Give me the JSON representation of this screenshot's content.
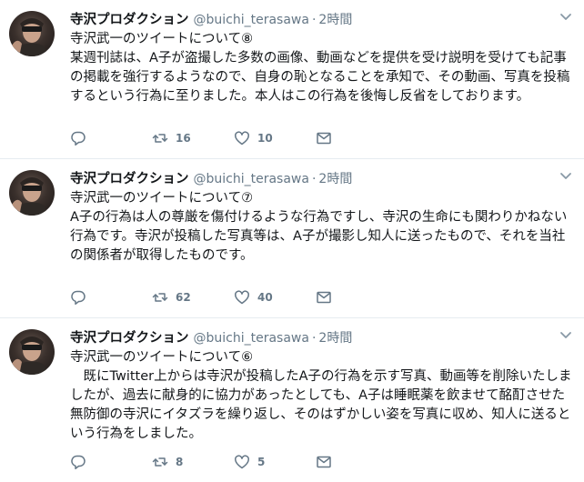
{
  "tweets": [
    {
      "name": "寺沢プロダクション",
      "handle": "@buichi_terasawa",
      "separator": "·",
      "time": "2時間",
      "lines": [
        "寺沢武一のツイートについて⑧",
        "某週刊誌は、A子が盗撮した多数の画像、動画などを提供を受け説明を受けても記事の掲載を強行するようなので、自身の恥となることを承知で、その動画、写真を投稿するという行為に至りました。本人はこの行為を後悔し反省をしております。"
      ],
      "replies": "",
      "retweets": "16",
      "likes": "10"
    },
    {
      "name": "寺沢プロダクション",
      "handle": "@buichi_terasawa",
      "separator": "·",
      "time": "2時間",
      "lines": [
        "寺沢武一のツイートについて⑦",
        "A子の行為は人の尊厳を傷付けるような行為ですし、寺沢の生命にも関わりかねない行為です。寺沢が投稿した写真等は、A子が撮影し知人に送ったもので、それを当社の関係者が取得したものです。"
      ],
      "replies": "",
      "retweets": "62",
      "likes": "40"
    },
    {
      "name": "寺沢プロダクション",
      "handle": "@buichi_terasawa",
      "separator": "·",
      "time": "2時間",
      "lines": [
        "寺沢武一のツイートについて⑥",
        "　既にTwitter上からは寺沢が投稿したA子の行為を示す写真、動画等を削除いたしましたが、過去に献身的に協力があったとしても、A子は睡眠薬を飲ませて酩酊させた無防御の寺沢にイタズラを繰り返し、そのはずかしい姿を写真に収め、知人に送るという行為をしました。"
      ],
      "replies": "",
      "retweets": "8",
      "likes": "5"
    }
  ],
  "icons": {
    "reply": "reply-icon",
    "retweet": "retweet-icon",
    "like": "heart-icon",
    "message": "envelope-icon",
    "caret": "chevron-down-icon"
  },
  "colors": {
    "text": "#14171a",
    "secondary": "#657786",
    "border": "#e6ecf0"
  }
}
